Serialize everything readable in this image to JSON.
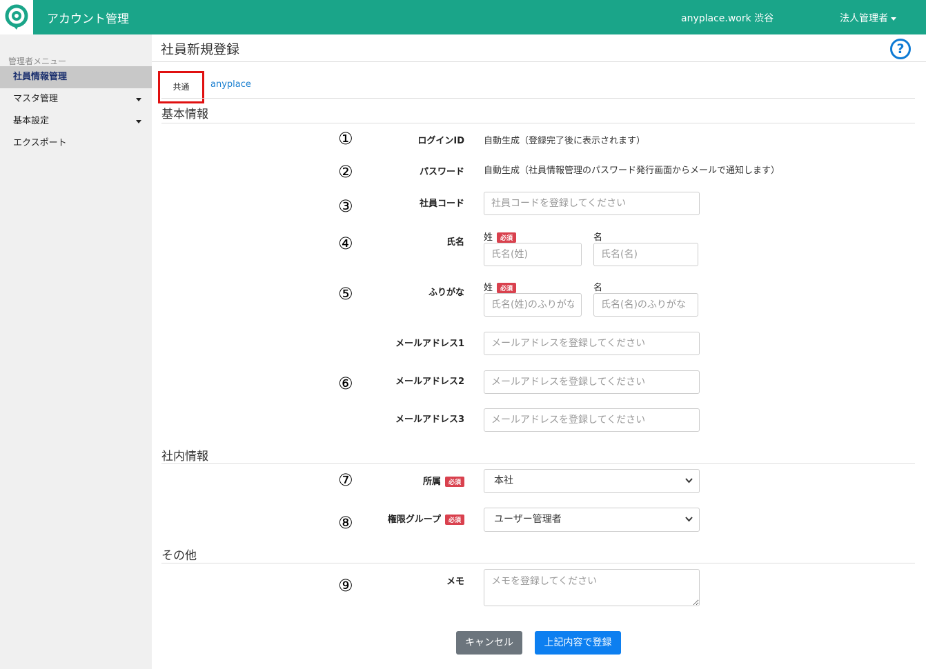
{
  "header": {
    "app_title": "アカウント管理",
    "company": "anyplace.work 渋谷",
    "user_menu": "法人管理者"
  },
  "sidebar": {
    "heading": "管理者メニュー",
    "items": [
      {
        "label": "社員情報管理"
      },
      {
        "label": "マスタ管理"
      },
      {
        "label": "基本設定"
      },
      {
        "label": "エクスポート"
      }
    ]
  },
  "page": {
    "title": "社員新規登録",
    "help_icon": "?"
  },
  "tabs": [
    {
      "label": "共通"
    },
    {
      "label": "anyplace"
    }
  ],
  "sections": {
    "basic": "基本情報",
    "company": "社内情報",
    "other": "その他"
  },
  "markers": [
    "①",
    "②",
    "③",
    "④",
    "⑤",
    "⑥",
    "⑦",
    "⑧",
    "⑨"
  ],
  "required_label": "必須",
  "form": {
    "login_id": {
      "label": "ログインID",
      "value": "自動生成（登録完了後に表示されます）"
    },
    "password": {
      "label": "パスワード",
      "value": "自動生成（社員情報管理のパスワード発行画面からメールで通知します）"
    },
    "employee_code": {
      "label": "社員コード",
      "placeholder": "社員コードを登録してください"
    },
    "name": {
      "label": "氏名",
      "last_label": "姓",
      "first_label": "名",
      "last_placeholder": "氏名(姓)",
      "first_placeholder": "氏名(名)"
    },
    "furigana": {
      "label": "ふりがな",
      "last_label": "姓",
      "first_label": "名",
      "last_placeholder": "氏名(姓)のふりがな",
      "first_placeholder": "氏名(名)のふりがな"
    },
    "email1": {
      "label": "メールアドレス1",
      "placeholder": "メールアドレスを登録してください"
    },
    "email2": {
      "label": "メールアドレス2",
      "placeholder": "メールアドレスを登録してください"
    },
    "email3": {
      "label": "メールアドレス3",
      "placeholder": "メールアドレスを登録してください"
    },
    "affiliation": {
      "label": "所属",
      "value": "本社"
    },
    "permission_group": {
      "label": "権限グループ",
      "value": "ユーザー管理者"
    },
    "memo": {
      "label": "メモ",
      "placeholder": "メモを登録してください"
    }
  },
  "buttons": {
    "cancel": "キャンセル",
    "submit": "上記内容で登録"
  }
}
